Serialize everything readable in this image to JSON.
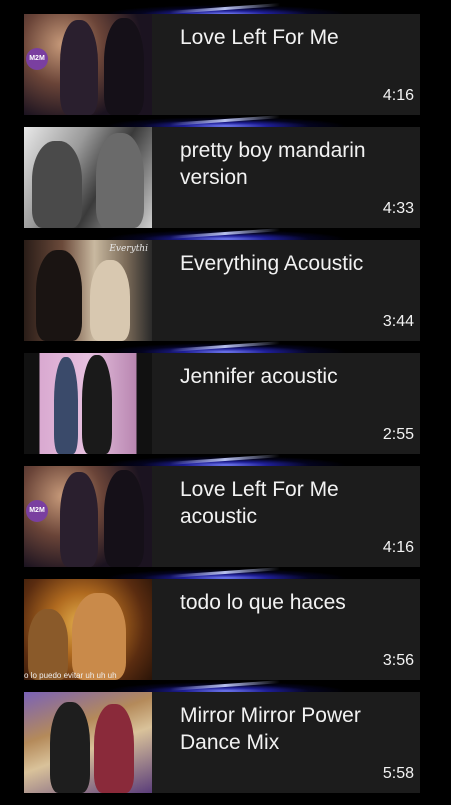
{
  "videos": [
    {
      "title": "Love Left For Me",
      "duration": "4:16",
      "thumb_badge": "M2M"
    },
    {
      "title": "pretty boy mandarin version",
      "duration": "4:33"
    },
    {
      "title": "Everything Acoustic",
      "duration": "3:44",
      "thumb_text": "Everythi"
    },
    {
      "title": "Jennifer acoustic",
      "duration": "2:55"
    },
    {
      "title": "Love Left For Me acoustic",
      "duration": "4:16",
      "thumb_badge": "M2M"
    },
    {
      "title": "todo lo que haces",
      "duration": "3:56",
      "thumb_caption": "o lo puedo evitar uh uh uh"
    },
    {
      "title": "Mirror Mirror Power Dance Mix",
      "duration": "5:58"
    }
  ],
  "colors": {
    "background": "#000000",
    "card": "#1c1c1c",
    "text": "#f2f2f2",
    "glow": "#3a3ad8"
  }
}
